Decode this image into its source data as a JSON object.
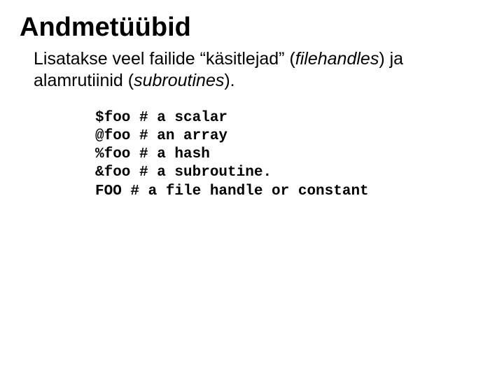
{
  "title": "Andmetüübid",
  "body": {
    "part1": "Lisatakse veel failide “käsitlejad” (",
    "italic1": "filehandles",
    "part2": ") ja alamrutiinid (",
    "italic2": "subroutines",
    "part3": ")."
  },
  "code": {
    "line1": "$foo # a scalar",
    "line2": "@foo # an array",
    "line3": "%foo # a hash",
    "line4": "&foo # a subroutine.",
    "line5": "FOO # a file handle or constant"
  }
}
